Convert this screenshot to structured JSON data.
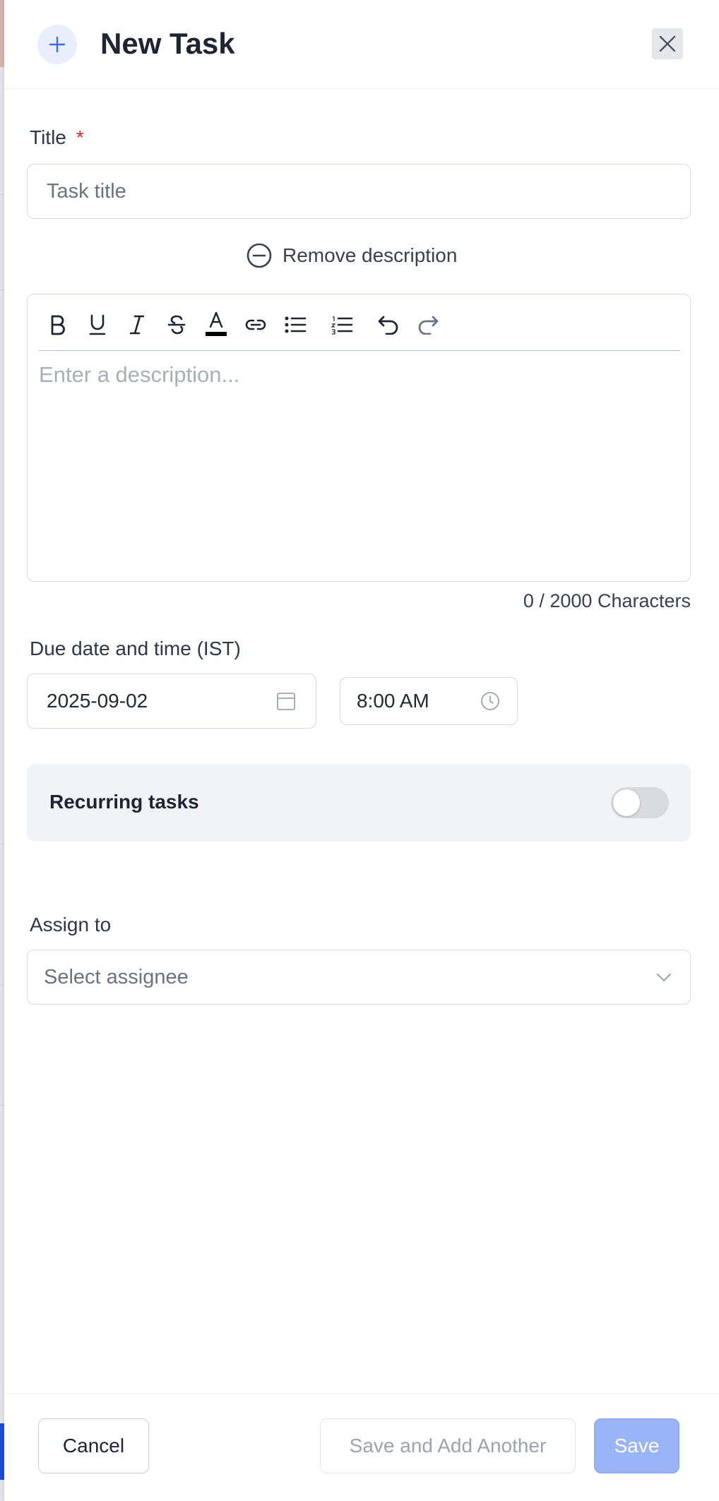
{
  "header": {
    "title": "New Task",
    "icon": "plus-icon",
    "close_icon": "close-icon"
  },
  "title_field": {
    "label": "Title",
    "required_mark": "*",
    "placeholder": "Task title",
    "value": ""
  },
  "remove_description": {
    "label": "Remove description",
    "icon": "minus-circle-icon"
  },
  "editor": {
    "toolbar": [
      "bold-icon",
      "underline-icon",
      "italic-icon",
      "strikethrough-icon",
      "text-color-icon",
      "link-icon",
      "bullet-list-icon",
      "numbered-list-icon",
      "undo-icon",
      "redo-icon"
    ],
    "placeholder": "Enter a description...",
    "char_count": "0 / 2000 Characters"
  },
  "due": {
    "label": "Due date and time (IST)",
    "date_value": "2025-09-02",
    "time_value": "8:00 AM"
  },
  "recurring": {
    "label": "Recurring tasks",
    "enabled": false
  },
  "assign": {
    "label": "Assign to",
    "placeholder": "Select assignee"
  },
  "footer": {
    "cancel_label": "Cancel",
    "save_another_label": "Save and Add Another",
    "save_label": "Save"
  },
  "colors": {
    "accent": "#3b6fe0",
    "save_disabled": "#9ab5f7",
    "required": "#dc2626"
  }
}
